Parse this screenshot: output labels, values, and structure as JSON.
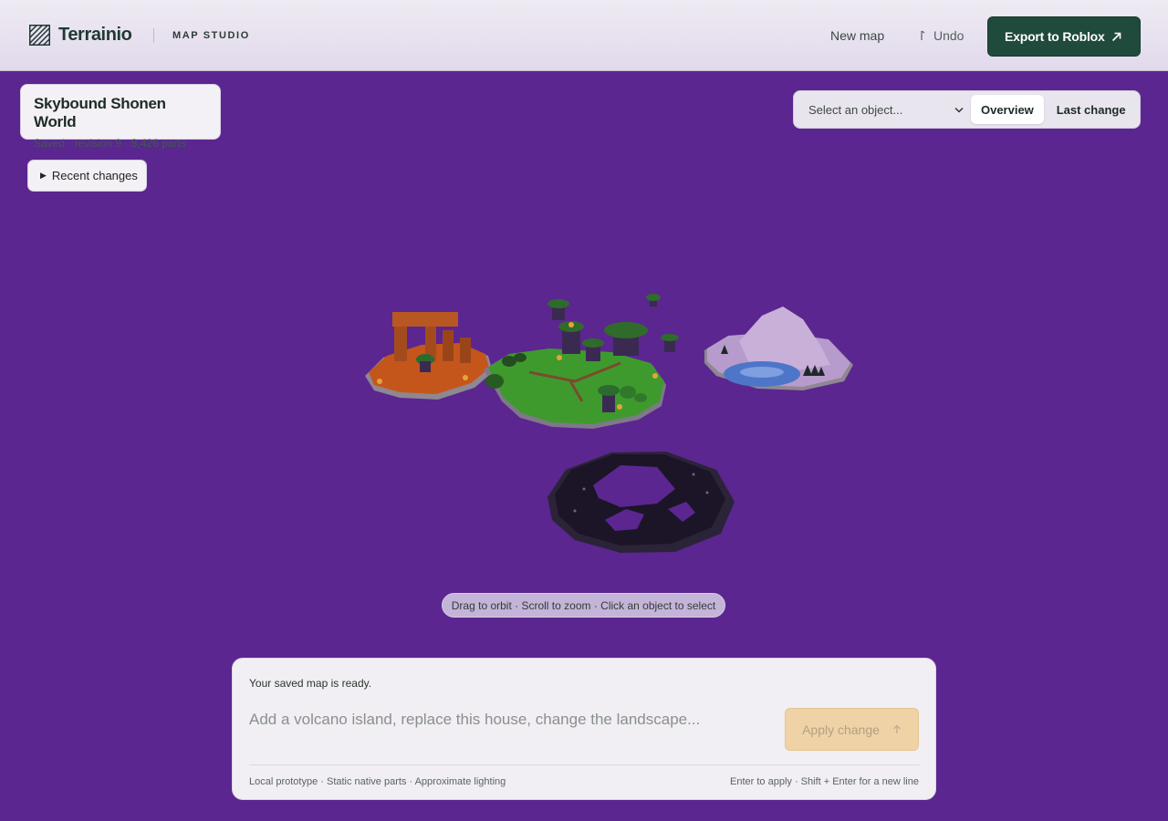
{
  "header": {
    "brand_name": "Terrainio",
    "brand_subtitle": "MAP STUDIO",
    "new_map_label": "New map",
    "undo_label": "Undo",
    "export_label": "Export to Roblox"
  },
  "project": {
    "title": "Skybound Shonen World",
    "meta": "Saved · revision 9 · 8,426 parts"
  },
  "recent_changes_label": "Recent changes",
  "camera": {
    "object_select_placeholder": "Select an object...",
    "overview_label": "Overview",
    "last_change_label": "Last change"
  },
  "viewport": {
    "hint": "Drag to orbit · Scroll to zoom · Click an object to select",
    "background_color": "#5b2690",
    "islands": [
      "desert-arch-island",
      "grass-village-island",
      "snow-mountain-island",
      "dark-crater-island"
    ]
  },
  "prompt": {
    "status": "Your saved map is ready.",
    "placeholder": "Add a volcano island, replace this house, change the landscape...",
    "apply_label": "Apply change",
    "footer_left": "Local prototype · Static native parts · Approximate lighting",
    "footer_right": "Enter to apply · Shift + Enter for a new line"
  },
  "colors": {
    "accent": "#1f4a3c",
    "apply_disabled": "#efd3a6"
  },
  "icons": {
    "logo": "hatched-square-logo",
    "undo": "undo-icon",
    "export": "arrow-up-right-icon",
    "select": "chevron-down-icon",
    "apply": "arrow-up-icon",
    "recent": "triangle-right-icon"
  }
}
